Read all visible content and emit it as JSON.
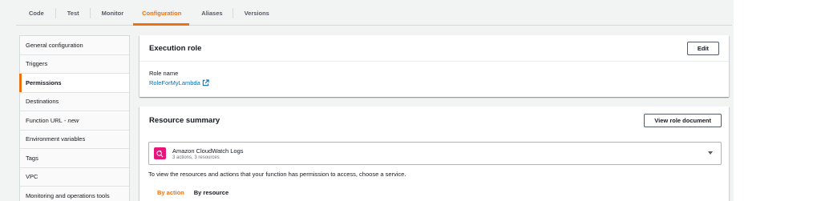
{
  "tabs": [
    {
      "label": "Code"
    },
    {
      "label": "Test"
    },
    {
      "label": "Monitor"
    },
    {
      "label": "Configuration"
    },
    {
      "label": "Aliases"
    },
    {
      "label": "Versions"
    }
  ],
  "active_tab": "Configuration",
  "sidebar": {
    "items": [
      {
        "label": "General configuration"
      },
      {
        "label": "Triggers"
      },
      {
        "label": "Permissions"
      },
      {
        "label": "Destinations"
      },
      {
        "label": "Function URL",
        "suffix": " - ",
        "badge": "new"
      },
      {
        "label": "Environment variables"
      },
      {
        "label": "Tags"
      },
      {
        "label": "VPC"
      },
      {
        "label": "Monitoring and operations tools"
      }
    ],
    "active": "Permissions"
  },
  "execution_role": {
    "title": "Execution role",
    "edit_label": "Edit",
    "role_name_label": "Role name",
    "role_name_value": "RoleForMyLambda"
  },
  "resource_summary": {
    "title": "Resource summary",
    "view_button_label": "View role document",
    "service": {
      "name": "Amazon CloudWatch Logs",
      "detail": "3 actions, 3 resources",
      "icon": "cloudwatch-icon"
    },
    "info_text": "To view the resources and actions that your function has permission to access, choose a service.",
    "subtabs": [
      {
        "label": "By action"
      },
      {
        "label": "By resource"
      }
    ],
    "active_subtab": "By action"
  },
  "colors": {
    "accent": "#ec7211",
    "link": "#0073bb",
    "service_icon_bg": "#e7157b"
  }
}
